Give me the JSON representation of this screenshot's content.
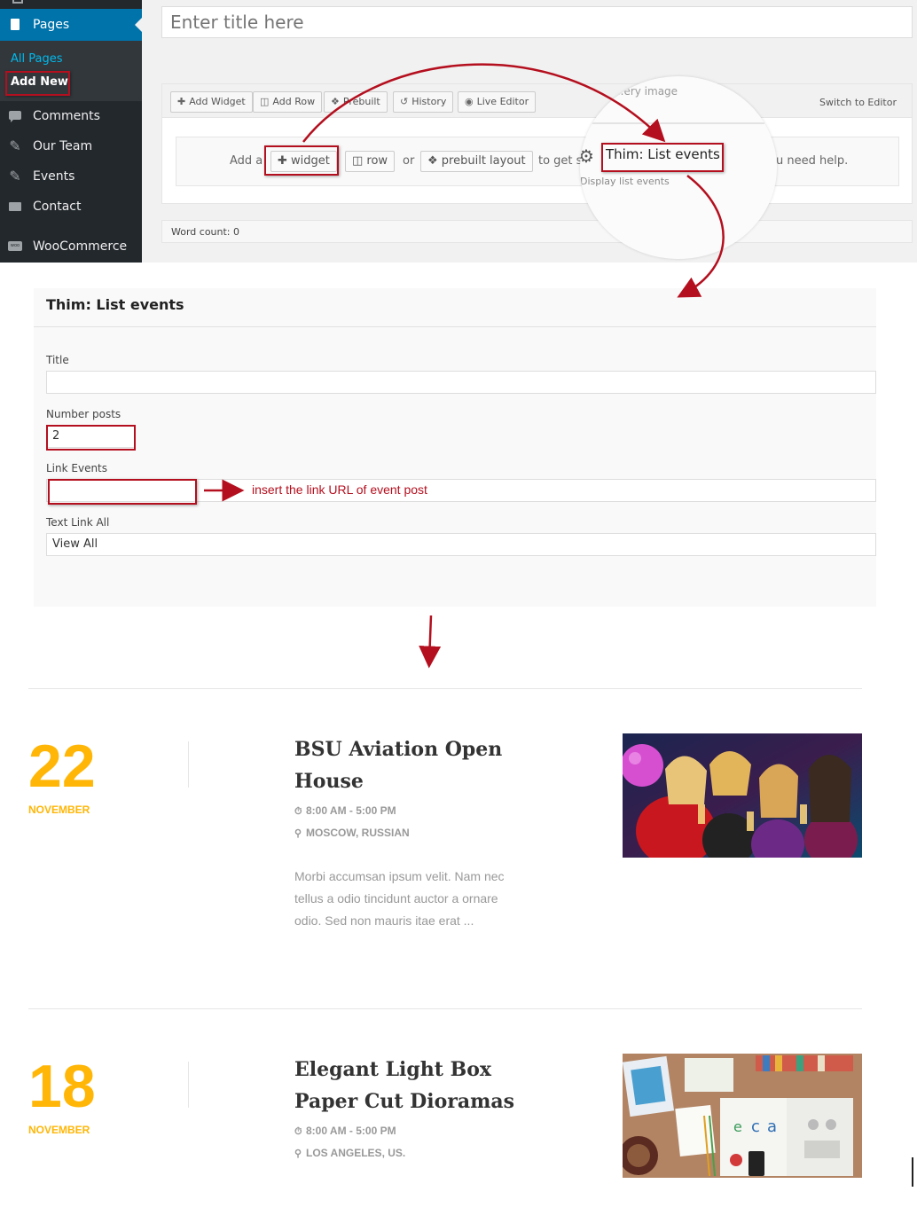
{
  "admin": {
    "sidebar": {
      "pages_label": "Pages",
      "sub_all_pages": "All Pages",
      "sub_add_new": "Add New",
      "items": [
        {
          "label": "Comments",
          "icon": "comments-icon"
        },
        {
          "label": "Our Team",
          "icon": "pin-icon"
        },
        {
          "label": "Events",
          "icon": "pin-icon"
        },
        {
          "label": "Contact",
          "icon": "mail-icon"
        },
        {
          "label": "WooCommerce",
          "icon": "woocommerce-icon"
        }
      ]
    },
    "title_placeholder": "Enter title here",
    "toolbar": {
      "add_widget": "Add Widget",
      "add_row": "Add Row",
      "prebuilt": "Prebuilt",
      "history": "History",
      "live_editor": "Live Editor",
      "switch_editor": "Switch to Editor"
    },
    "drop_area": {
      "add_a": "Add a",
      "widget_btn": "widget",
      "row_btn": "row",
      "or": "or",
      "prebuilt_btn": "prebuilt layout",
      "to_get": "to get s",
      "need_help": "u need help."
    },
    "word_count": "Word count: 0",
    "magnifier": {
      "gallery": "...ery image",
      "widget_title": "Thim: List events",
      "widget_desc": "Display list events"
    }
  },
  "widget_form": {
    "title": "Thim: List events",
    "fields": [
      {
        "label": "Title",
        "value": ""
      },
      {
        "label": "Number posts",
        "value": "2"
      },
      {
        "label": "Link Events",
        "value": ""
      },
      {
        "label": "Text Link All",
        "value": "View All"
      }
    ],
    "annotation": "insert the link URL of event post"
  },
  "events": [
    {
      "day": "22",
      "month": "NOVEMBER",
      "title": "BSU Aviation Open House",
      "time": "8:00 AM - 5:00 PM",
      "location": "MOSCOW, RUSSIAN",
      "description": "Morbi accumsan ipsum velit. Nam nec tellus a odio tincidunt auctor a ornare odio. Sed non mauris itae erat ..."
    },
    {
      "day": "18",
      "month": "NOVEMBER",
      "title": "Elegant Light Box Paper Cut Dioramas",
      "time": "8:00 AM - 5:00 PM",
      "location": "LOS ANGELES, US."
    }
  ],
  "colors": {
    "accent": "#ffb606",
    "annotation_red": "#b40f1e",
    "wp_blue": "#0073aa",
    "sidebar_dark": "#23282d"
  }
}
